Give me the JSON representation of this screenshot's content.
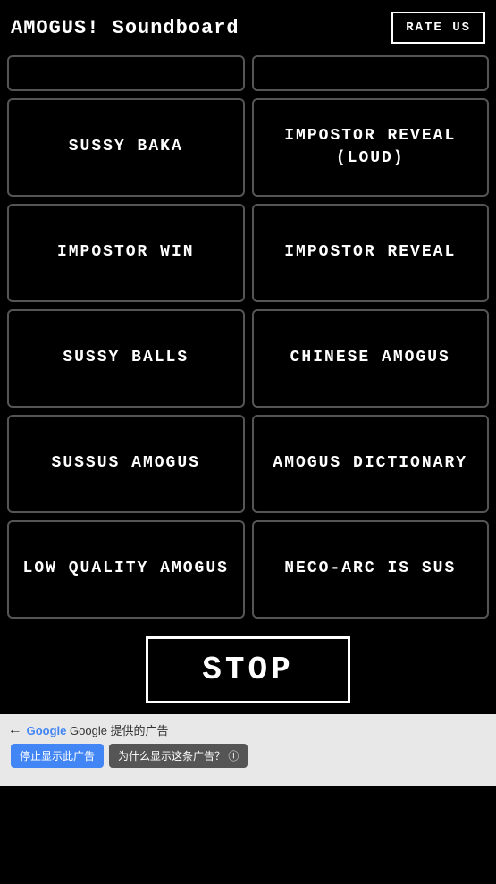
{
  "header": {
    "title": "AMOGUS! Soundboard",
    "rate_btn": "RATE US"
  },
  "partial_top": [
    {
      "label": ""
    },
    {
      "label": ""
    }
  ],
  "sounds": [
    {
      "id": "sussy-baka",
      "label": "SUSSY BAKA"
    },
    {
      "id": "impostor-reveal-loud",
      "label": "IMPOSTOR REVEAL\n(LOUD)"
    },
    {
      "id": "impostor-win",
      "label": "IMPOSTOR WIN"
    },
    {
      "id": "impostor-reveal",
      "label": "IMPOSTOR REVEAL"
    },
    {
      "id": "sussy-balls",
      "label": "SUSSY BALLS"
    },
    {
      "id": "chinese-amogus",
      "label": "CHINESE AMOGUS"
    },
    {
      "id": "sussus-amogus",
      "label": "SUSSUS AMOGUS"
    },
    {
      "id": "amogus-dictionary",
      "label": "AMOGUS DICTIONARY"
    },
    {
      "id": "low-quality-amogus",
      "label": "LOW QUALITY AMOGUS"
    },
    {
      "id": "neco-arc-is-sus",
      "label": "NECO-ARC IS SUS"
    }
  ],
  "stop_btn": "STOP",
  "ad": {
    "back_arrow": "←",
    "provided_by": "Google 提供的广告",
    "stop_showing": "停止显示此广告",
    "why_showing": "为什么显示这条广告？",
    "info_icon": "ⓘ"
  }
}
